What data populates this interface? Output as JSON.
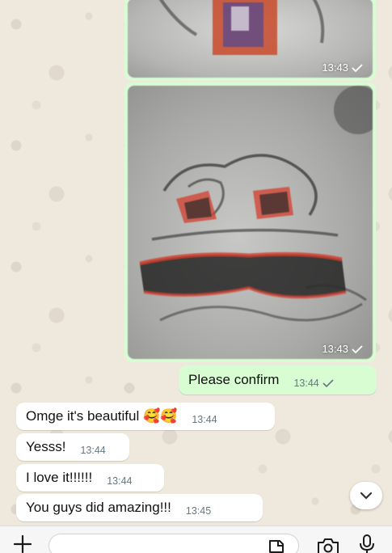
{
  "messages": [
    {
      "kind": "image",
      "direction": "out",
      "time": "13:43"
    },
    {
      "kind": "image",
      "direction": "out",
      "time": "13:43"
    },
    {
      "kind": "text",
      "direction": "out",
      "text": "Please confirm",
      "time": "13:44"
    },
    {
      "kind": "text",
      "direction": "in",
      "text": "Omge it's beautiful 🥰🥰",
      "time": "13:44"
    },
    {
      "kind": "text",
      "direction": "in",
      "text": "Yesss!",
      "time": "13:44"
    },
    {
      "kind": "text",
      "direction": "in",
      "text": "I love it!!!!!!",
      "time": "13:44"
    },
    {
      "kind": "text",
      "direction": "in",
      "text": "You guys did amazing!!!",
      "time": "13:45"
    }
  ],
  "input_bar": {
    "icons": [
      "plus-icon",
      "sticker-icon",
      "camera-icon",
      "microphone-icon"
    ],
    "message_placeholder": ""
  },
  "scroll_button": {
    "icon": "chevron-down-icon"
  },
  "colors": {
    "outgoing_bubble": "#d9fdd3",
    "incoming_bubble": "#ffffff",
    "background": "#efe8dd",
    "meta_text": "#667781",
    "tick": "#667781"
  }
}
